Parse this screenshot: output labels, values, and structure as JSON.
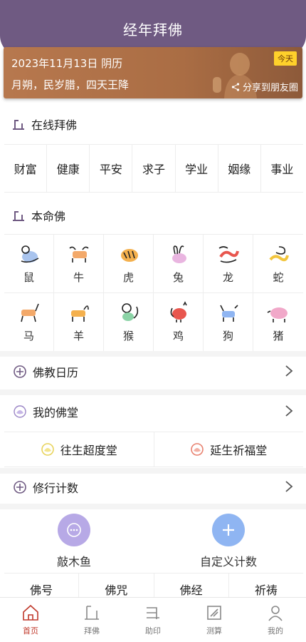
{
  "header": {
    "title": "经年拜佛"
  },
  "banner": {
    "date_line": "2023年11月13日 阴历",
    "events_line": "月朔，民岁腊，四天王降",
    "today_badge": "今天",
    "share_label": "分享到朋友圈"
  },
  "online_worship": {
    "title": "在线拜佛",
    "items": [
      "财富",
      "健康",
      "平安",
      "求子",
      "学业",
      "姻缘",
      "事业"
    ]
  },
  "patron_buddha": {
    "title": "本命佛",
    "zodiac": [
      "鼠",
      "牛",
      "虎",
      "兔",
      "龙",
      "蛇",
      "马",
      "羊",
      "猴",
      "鸡",
      "狗",
      "猪"
    ]
  },
  "calendar_row": {
    "label": "佛教日历"
  },
  "my_hall_row": {
    "label": "我的佛堂"
  },
  "halls": {
    "left": "往生超度堂",
    "right": "延生祈福堂"
  },
  "practice_row": {
    "label": "修行计数"
  },
  "counters": {
    "woodfish": "敲木鱼",
    "custom": "自定义计数"
  },
  "practice_tabs": [
    "佛号",
    "佛咒",
    "佛经",
    "祈祷"
  ],
  "bottom_nav": [
    {
      "label": "首页",
      "active": true
    },
    {
      "label": "拜佛",
      "active": false
    },
    {
      "label": "助印",
      "active": false
    },
    {
      "label": "测算",
      "active": false
    },
    {
      "label": "我的",
      "active": false
    }
  ],
  "colors": {
    "header": "#6f5a82",
    "banner": "#b7784e",
    "badge": "#ffd12b",
    "woodfish_circle": "#b7a9e6",
    "custom_circle": "#8fb5f2",
    "nav_active": "#c0392b"
  }
}
